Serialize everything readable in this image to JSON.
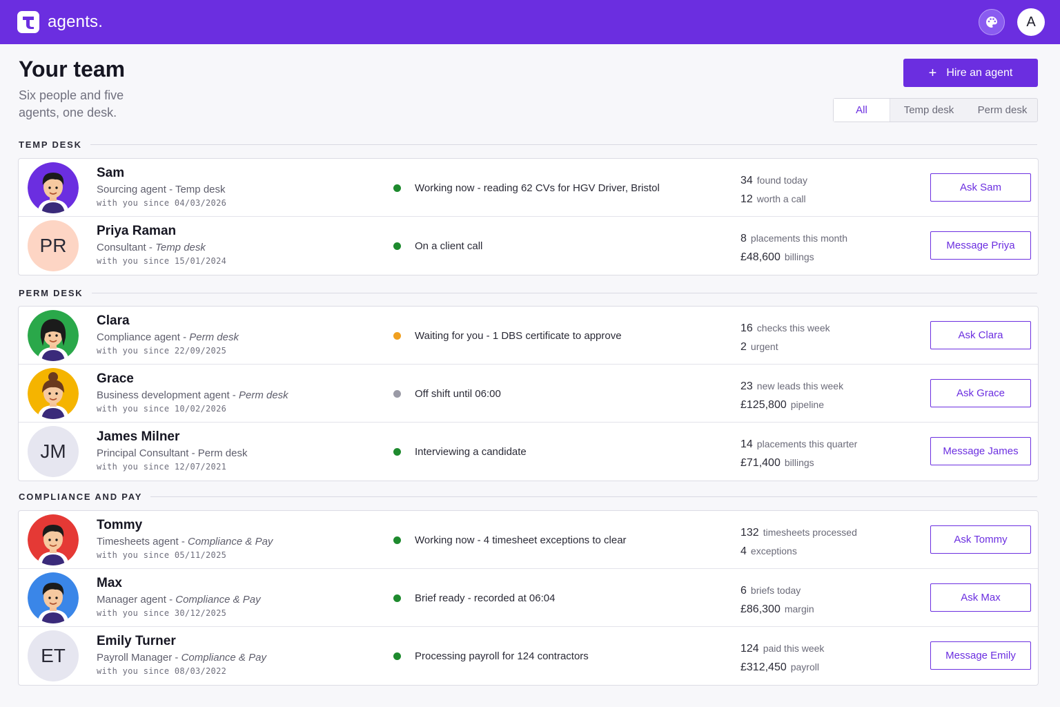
{
  "app": {
    "name": "agents."
  },
  "topbar": {
    "avatar_letter": "A",
    "palette_icon": "palette-icon"
  },
  "header": {
    "title": "Your team",
    "subtitle": "Six people and five agents, one desk.",
    "hire_label": "Hire an agent",
    "filters": [
      "All",
      "Temp desk",
      "Perm desk"
    ],
    "active_filter": "All"
  },
  "colors": {
    "brand": "#6b2ee0",
    "working": "#1e8a2e",
    "waiting": "#f0a020",
    "off": "#9a9aa6"
  },
  "sections": [
    {
      "label": "TEMP DESK",
      "members": [
        {
          "name": "Sam",
          "role": "Sourcing agent",
          "desk": "Temp desk",
          "since": "with you since 04/03/2026",
          "status": "Working now - reading 62 CVs for HGV Driver, Bristol",
          "status_color": "#1e8a2e",
          "stat1_value": "34",
          "stat1_label": "found today",
          "stat2_value": "12",
          "stat2_label": "worth a call",
          "action": "Ask Sam",
          "avatar": "agent",
          "avatar_bg": "#6b2ee0",
          "desk_italic": false
        },
        {
          "name": "Priya Raman",
          "role": "Consultant",
          "desk": "Temp desk",
          "since": "with you since 15/01/2024",
          "status": "On a client call",
          "status_color": "#1e8a2e",
          "stat1_value": "8",
          "stat1_label": "placements this month",
          "stat2_value": "£48,600",
          "stat2_label": "billings",
          "action": "Message Priya",
          "avatar": "initials",
          "initials": "PR",
          "avatar_bg": "#fdd5c4",
          "desk_italic": true
        }
      ]
    },
    {
      "label": "PERM DESK",
      "members": [
        {
          "name": "Clara",
          "role": "Compliance agent",
          "desk": "Perm desk",
          "since": "with you since 22/09/2025",
          "status": "Waiting for you - 1 DBS certificate to approve",
          "status_color": "#f0a020",
          "stat1_value": "16",
          "stat1_label": "checks this week",
          "stat2_value": "2",
          "stat2_label": "urgent",
          "action": "Ask Clara",
          "avatar": "agent",
          "avatar_bg": "#2aa84a",
          "desk_italic": true
        },
        {
          "name": "Grace",
          "role": "Business development agent",
          "desk": "Perm desk",
          "since": "with you since 10/02/2026",
          "status": "Off shift until  06:00",
          "status_color": "#9a9aa6",
          "stat1_value": "23",
          "stat1_label": "new leads this week",
          "stat2_value": "£125,800",
          "stat2_label": "pipeline",
          "action": "Ask Grace",
          "avatar": "agent",
          "avatar_bg": "#f5b400",
          "desk_italic": true
        },
        {
          "name": "James Milner",
          "role": "Principal Consultant",
          "desk": "Perm desk",
          "since": "with you since 12/07/2021",
          "status": "Interviewing a candidate",
          "status_color": "#1e8a2e",
          "stat1_value": "14",
          "stat1_label": "placements this quarter",
          "stat2_value": "£71,400",
          "stat2_label": "billings",
          "action": "Message James",
          "avatar": "initials",
          "initials": "JM",
          "avatar_bg": "#e6e6f0",
          "desk_italic": false
        }
      ]
    },
    {
      "label": "COMPLIANCE AND PAY",
      "members": [
        {
          "name": "Tommy",
          "role": "Timesheets agent",
          "desk": "Compliance & Pay",
          "since": "with you since 05/11/2025",
          "status": "Working now - 4 timesheet exceptions to clear",
          "status_color": "#1e8a2e",
          "stat1_value": "132",
          "stat1_label": "timesheets processed",
          "stat2_value": "4",
          "stat2_label": "exceptions",
          "action": "Ask Tommy",
          "avatar": "agent",
          "avatar_bg": "#e53935",
          "desk_italic": true
        },
        {
          "name": "Max",
          "role": "Manager agent",
          "desk": "Compliance & Pay",
          "since": "with you since 30/12/2025",
          "status": "Brief ready - recorded at 06:04",
          "status_color": "#1e8a2e",
          "stat1_value": "6",
          "stat1_label": "briefs today",
          "stat2_value": "£86,300",
          "stat2_label": "margin",
          "action": "Ask Max",
          "avatar": "agent",
          "avatar_bg": "#3a86e8",
          "desk_italic": true
        },
        {
          "name": "Emily Turner",
          "role": "Payroll Manager",
          "desk": "Compliance & Pay",
          "since": "with you since 08/03/2022",
          "status": "Processing payroll for 124 contractors",
          "status_color": "#1e8a2e",
          "stat1_value": "124",
          "stat1_label": "paid this week",
          "stat2_value": "£312,450",
          "stat2_label": "payroll",
          "action": "Message Emily",
          "avatar": "initials",
          "initials": "ET",
          "avatar_bg": "#e6e6f0",
          "desk_italic": true
        }
      ]
    }
  ]
}
